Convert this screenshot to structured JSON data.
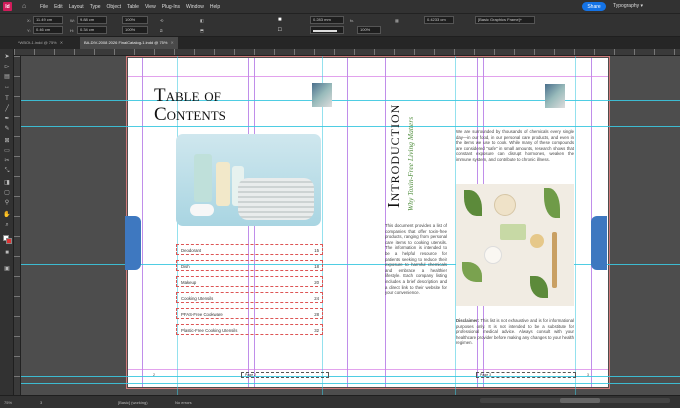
{
  "app": {
    "logo": "Id"
  },
  "menu": [
    "File",
    "Edit",
    "Layout",
    "Type",
    "Object",
    "Table",
    "View",
    "Plug-Ins",
    "Window",
    "Help"
  ],
  "share_label": "Share",
  "workspace_label": "Typography",
  "controls": {
    "x": "11.49 cm",
    "y": "0.46 cm",
    "w": "9.88 cm",
    "h": "0.34 cm",
    "scale_w": "100%",
    "scale_h": "100%",
    "stroke_weight": "0.283 mm",
    "opacity": "100%",
    "ref_w": "0.4233 cm",
    "frame_style": "[Basic Graphics Frame]+"
  },
  "tabs": [
    {
      "label": "*WBOt-1.indd @ 75%",
      "active": false
    },
    {
      "label": "BA-DIV-2008 2026 FinalCatalog-1.indd @ 75%",
      "active": true
    }
  ],
  "left_page": {
    "title_line1": "Table of",
    "title_line2": "Contents",
    "toc": [
      {
        "name": "Deodorant",
        "page": "15"
      },
      {
        "name": "Dish",
        "page": "18"
      },
      {
        "name": "Makeup",
        "page": "20"
      },
      {
        "name": "Cooking Utensils",
        "page": "24"
      },
      {
        "name": "PFAS-Free Cookware",
        "page": "28"
      },
      {
        "name": "Plastic-Free Cooking Utensils",
        "page": "32"
      }
    ],
    "page_number": "2",
    "footer_label": "Page 2"
  },
  "right_page": {
    "title": "Introduction",
    "subtitle": "Why Toxin-Free Living Matters",
    "para1": "We are surrounded by thousands of chemicals every single day—in our food, in our personal care products, and even in the items we use to cook. While many of these compounds are considered \"safe\" in small amounts, research shows that constant exposure can disrupt hormones, weaken the immune system, and contribute to chronic illness.",
    "para2": "This document provides a list of companies that offer toxin-free products, ranging from personal care items to cooking utensils. The information is intended to be a helpful resource for patients seeking to reduce their exposure to harmful chemicals and embrace a healthier lifestyle. Each company listing includes a brief description and a direct link to their website for your convenience.",
    "disclaimer_label": "Disclaimer:",
    "disclaimer_text": "This list is not exhaustive and is for informational purposes only. It is not intended to be a substitute for professional medical advice. Always consult with your healthcare provider before making any changes to your health regimen.",
    "page_number": "3",
    "footer_label": "Page 3"
  },
  "status": {
    "zoom": "75%",
    "page_field": "3",
    "style": "[Basic] (working)",
    "errors": "No errors"
  }
}
